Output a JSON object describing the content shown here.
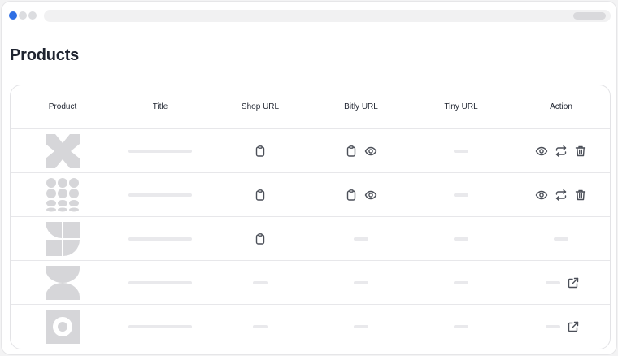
{
  "window": {
    "accent": "#2f6fe4"
  },
  "page": {
    "title": "Products"
  },
  "table": {
    "columns": [
      "Product",
      "Title",
      "Shop URL",
      "Bitly URL",
      "Tiny URL",
      "Action"
    ],
    "rows": [
      {
        "product_image": "x-shape-logo",
        "title": "",
        "shop_url": [
          "copy-icon"
        ],
        "bitly_url": [
          "copy-icon",
          "eye-icon"
        ],
        "tiny_url": "",
        "actions": [
          "eye-icon",
          "repeat-icon",
          "trash-icon"
        ]
      },
      {
        "product_image": "dots-grid-logo",
        "title": "",
        "shop_url": [
          "copy-icon"
        ],
        "bitly_url": [
          "copy-icon",
          "eye-icon"
        ],
        "tiny_url": "",
        "actions": [
          "eye-icon",
          "repeat-icon",
          "trash-icon"
        ]
      },
      {
        "product_image": "pinwheel-logo",
        "title": "",
        "shop_url": [
          "copy-icon"
        ],
        "bitly_url": [],
        "tiny_url": "",
        "actions": []
      },
      {
        "product_image": "hourglass-logo",
        "title": "",
        "shop_url": [],
        "bitly_url": [],
        "tiny_url": "",
        "actions": [
          "external-link-icon"
        ]
      },
      {
        "product_image": "ring-logo",
        "title": "",
        "shop_url": [],
        "bitly_url": [],
        "tiny_url": "",
        "actions": [
          "external-link-icon"
        ]
      }
    ]
  }
}
